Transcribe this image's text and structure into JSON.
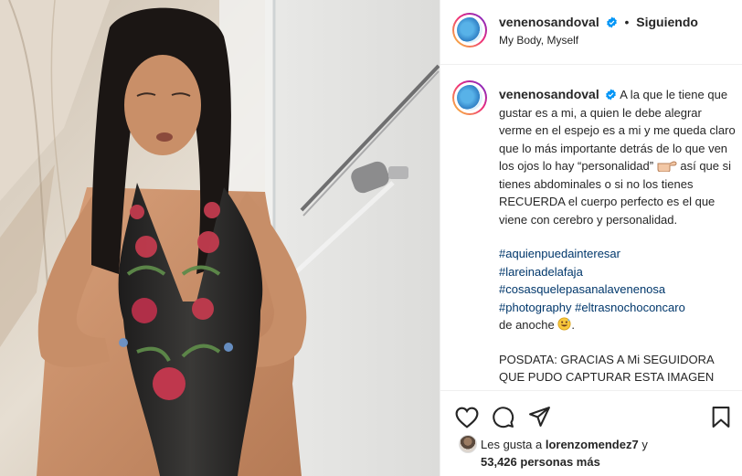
{
  "post_author": {
    "username": "venenosandoval",
    "follow_status": "Siguiendo",
    "subtitle": "My Body, Myself",
    "avatar_icon": "profile-avatar"
  },
  "caption": {
    "username": "venenosandoval",
    "paragraph1_a": "A la que le tiene que gustar es a mi, a quien le debe alegrar verme en el espejo es a mi y me queda claro que lo más importante detrás de lo que ven los ojos lo hay “personalidad”",
    "paragraph1_b": "así que si tienes abdominales o si no los tienes RECUERDA el cuerpo perfecto es el que viene con cerebro y personalidad.",
    "pointing_emoji": "point-right-icon",
    "hashtags": [
      "#aquienpuedainteresar",
      "#lareinadelafaja",
      "#cosasquelepasanalavenenosa"
    ],
    "hashtag_line4a": "#photography",
    "hashtag_line4b": "#eltrasnochoconcaro",
    "line5": "de anoche",
    "smile_emoji": "grinning-sweat-icon",
    "paragraph2": "POSDATA: GRACIAS A Mi SEGUIDORA QUE PUDO CAPTURAR ESTA IMAGEN"
  },
  "actions": {
    "like_icon": "heart-icon",
    "comment_icon": "comment-icon",
    "share_icon": "share-icon",
    "save_icon": "bookmark-icon"
  },
  "likes": {
    "prefix": "Les gusta a",
    "friend": "lorenzomendez7",
    "connector": "y",
    "count_text": "53,426 personas más"
  },
  "colors": {
    "link": "#00376b",
    "text": "#262626",
    "verified": "#0095f6"
  }
}
